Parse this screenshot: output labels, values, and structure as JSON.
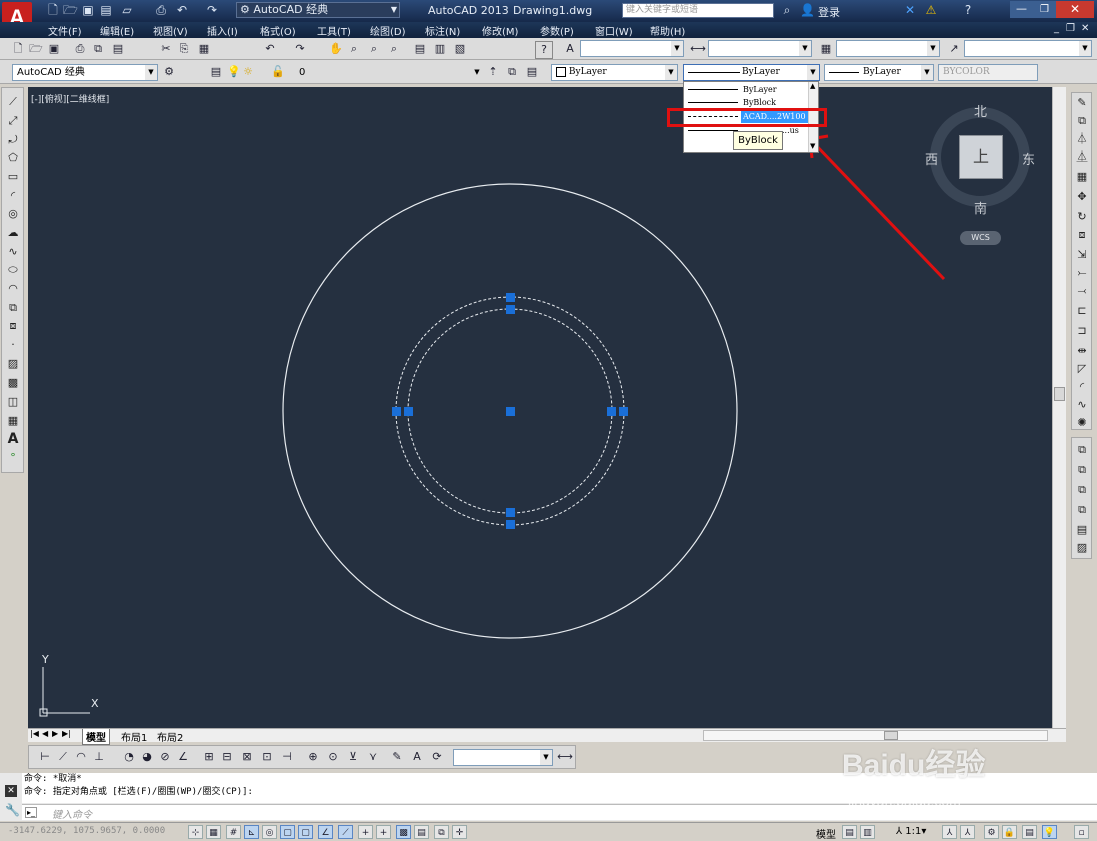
{
  "titlebar": {
    "workspace": "AutoCAD 经典",
    "app_name": "AutoCAD 2013",
    "document": "Drawing1.dwg",
    "search_placeholder": "键入关键字或短语",
    "login": "登录"
  },
  "menu": [
    "文件(F)",
    "编辑(E)",
    "视图(V)",
    "插入(I)",
    "格式(O)",
    "工具(T)",
    "绘图(D)",
    "标注(N)",
    "修改(M)",
    "参数(P)",
    "窗口(W)",
    "帮助(H)"
  ],
  "workspace_combo": "AutoCAD 经典",
  "layer_combo": "0",
  "properties": {
    "color": "ByLayer",
    "linetype": "ByLayer",
    "lineweight": "ByLayer",
    "plotstyle": "BYCOLOR"
  },
  "linetype_dropdown": {
    "items": [
      "ByLayer",
      "ByBlock",
      "ACAD....2W100",
      "...us"
    ],
    "selected_index": 2,
    "tooltip": "ByBlock"
  },
  "viewport_label": "[-][俯视][二维线框]",
  "viewcube": {
    "north": "北",
    "south": "南",
    "east": "东",
    "west": "西",
    "face": "上",
    "ucs_button": "WCS"
  },
  "ucs_axes": {
    "x": "X",
    "y": "Y"
  },
  "layout_tabs": [
    "模型",
    "布局1",
    "布局2"
  ],
  "command_history": [
    "命令: *取消*",
    "命令: 指定对角点或 [栏选(F)/圈围(WP)/圈交(CP)]:"
  ],
  "command_input_placeholder": "键入命令",
  "status": {
    "coords": "-3147.6229, 1075.9657, 0.0000",
    "model_label": "模型",
    "annotation_scale": "1:1"
  },
  "watermark": {
    "brand": "Baidu经验",
    "url": "jingyan.baidu.com"
  },
  "colors": {
    "canvas_bg": "#253040",
    "grip": "#1a6fd8",
    "highlight_box": "#e01010",
    "selected_item": "#3399ff"
  }
}
